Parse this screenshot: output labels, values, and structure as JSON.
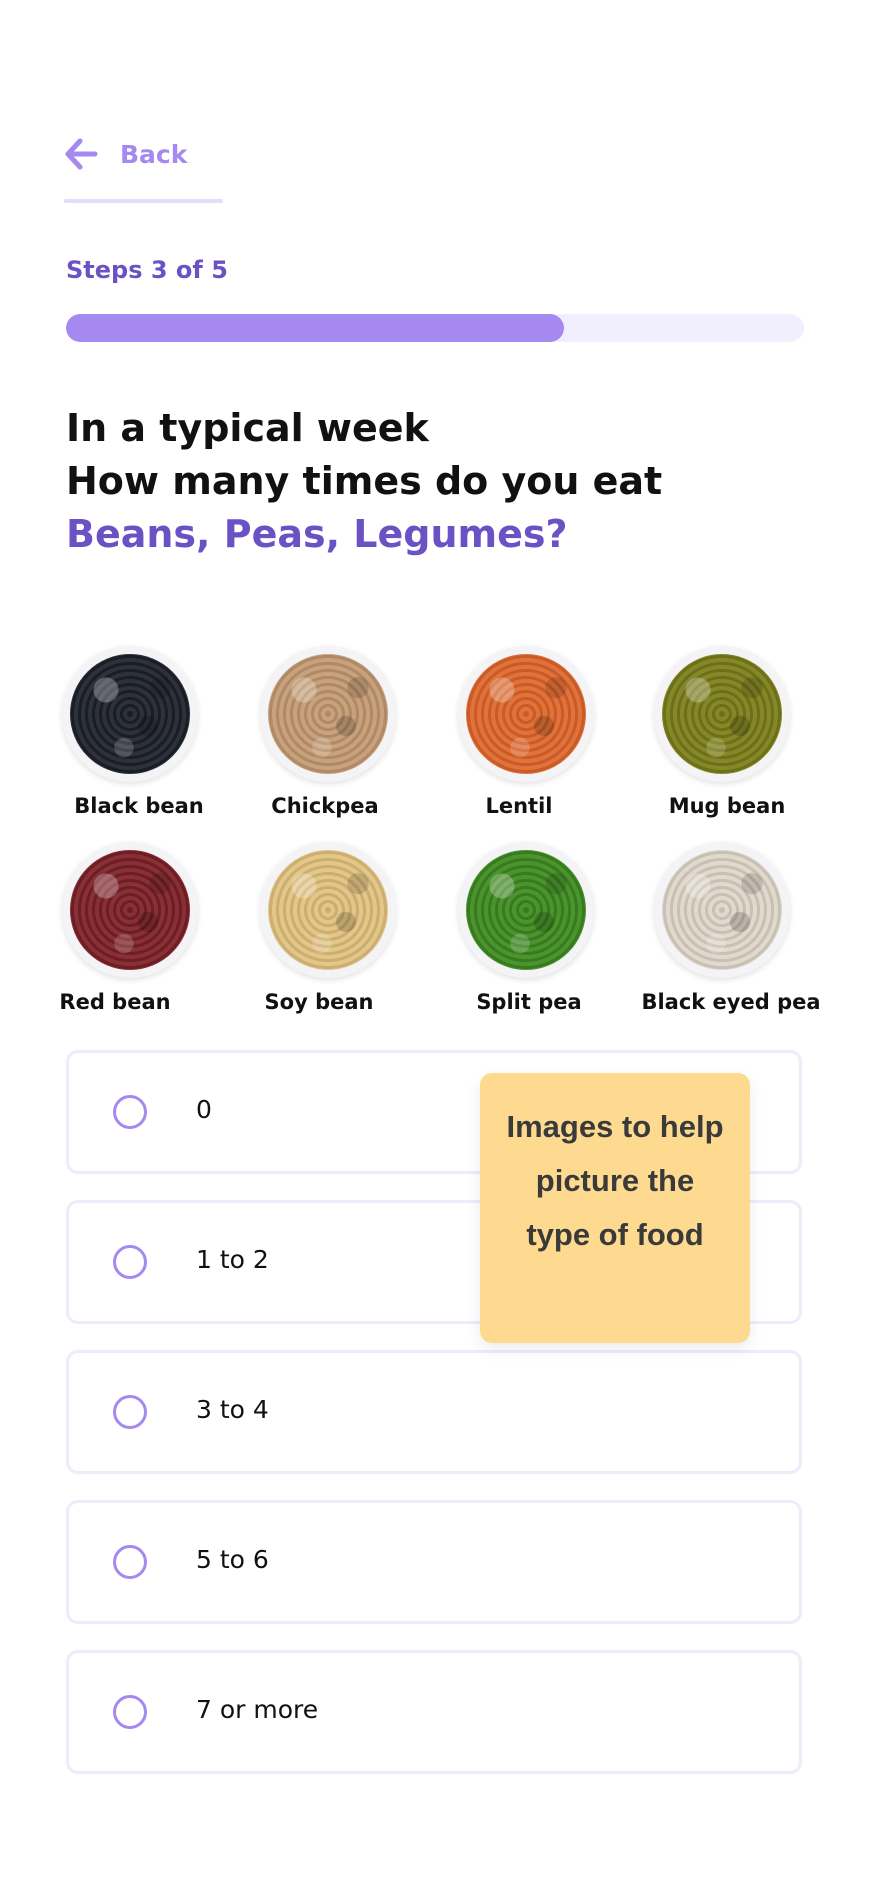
{
  "nav": {
    "back_label": "Back",
    "back_icon": "arrow-left-icon"
  },
  "progress": {
    "steps_text": "Steps 3 of 5",
    "fraction": 0.675
  },
  "question": {
    "line1": "In a typical week",
    "line2": "How many times do you eat",
    "food": "Beans, Peas, Legumes?"
  },
  "legumes": [
    {
      "name": "Black bean",
      "color": "#1c2029"
    },
    {
      "name": "Chickpea",
      "color": "#c49a72"
    },
    {
      "name": "Lentil",
      "color": "#e0662a"
    },
    {
      "name": "Mug bean",
      "color": "#7a7d18"
    },
    {
      "name": "Red bean",
      "color": "#7c1f26"
    },
    {
      "name": "Soy bean",
      "color": "#e2c27e"
    },
    {
      "name": "Split pea",
      "color": "#3d8a1f"
    },
    {
      "name": "Black eyed pea",
      "color": "#ded6c8"
    }
  ],
  "options": [
    {
      "label": "0"
    },
    {
      "label": "1 to 2"
    },
    {
      "label": "3 to 4"
    },
    {
      "label": "5 to 6"
    },
    {
      "label": "7 or more"
    }
  ],
  "tooltip": {
    "text": "Images to help picture the type of food"
  },
  "colors": {
    "accent": "#a589f0",
    "accent_dark": "#6b52c4",
    "tooltip_bg": "#fdda8f"
  }
}
